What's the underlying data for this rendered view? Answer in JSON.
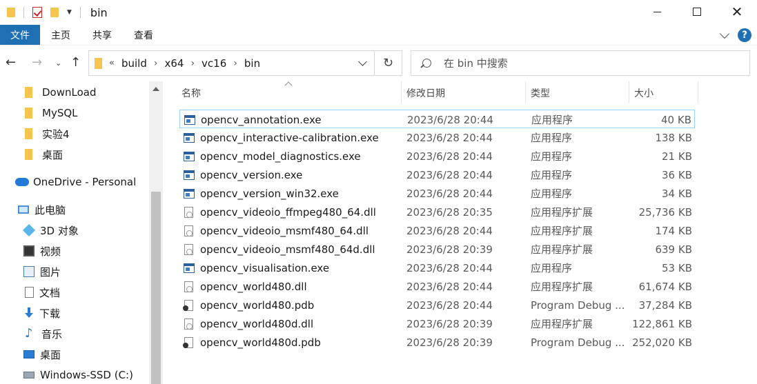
{
  "window": {
    "title": "bin"
  },
  "ribbon": {
    "tabs": [
      "文件",
      "主页",
      "共享",
      "查看"
    ]
  },
  "address": {
    "crumbs": [
      "build",
      "x64",
      "vc16",
      "bin"
    ],
    "overflow": "«"
  },
  "search": {
    "placeholder": "在 bin 中搜索"
  },
  "sidebar": {
    "items": [
      {
        "label": "DownLoad",
        "icon": "folder-icon"
      },
      {
        "label": "MySQL",
        "icon": "folder-icon"
      },
      {
        "label": "实验4",
        "icon": "folder-icon"
      },
      {
        "label": "桌面",
        "icon": "folder-icon"
      },
      {
        "label": "OneDrive - Personal",
        "icon": "onedrive-icon"
      },
      {
        "label": "此电脑",
        "icon": "computer-icon"
      },
      {
        "label": "3D 对象",
        "icon": "3d-objects-icon"
      },
      {
        "label": "视频",
        "icon": "video-icon"
      },
      {
        "label": "图片",
        "icon": "picture-icon"
      },
      {
        "label": "文档",
        "icon": "document-icon"
      },
      {
        "label": "下载",
        "icon": "download-icon"
      },
      {
        "label": "音乐",
        "icon": "music-icon"
      },
      {
        "label": "桌面",
        "icon": "desktop-icon"
      },
      {
        "label": "Windows-SSD (C:)",
        "icon": "drive-icon"
      }
    ]
  },
  "columns": {
    "name": "名称",
    "date": "修改日期",
    "type": "类型",
    "size": "大小"
  },
  "files": [
    {
      "name": "opencv_annotation.exe",
      "date": "2023/6/28 20:44",
      "type": "应用程序",
      "size": "40 KB",
      "kind": "exe"
    },
    {
      "name": "opencv_interactive-calibration.exe",
      "date": "2023/6/28 20:44",
      "type": "应用程序",
      "size": "138 KB",
      "kind": "exe"
    },
    {
      "name": "opencv_model_diagnostics.exe",
      "date": "2023/6/28 20:44",
      "type": "应用程序",
      "size": "21 KB",
      "kind": "exe"
    },
    {
      "name": "opencv_version.exe",
      "date": "2023/6/28 20:44",
      "type": "应用程序",
      "size": "36 KB",
      "kind": "exe"
    },
    {
      "name": "opencv_version_win32.exe",
      "date": "2023/6/28 20:44",
      "type": "应用程序",
      "size": "34 KB",
      "kind": "exe"
    },
    {
      "name": "opencv_videoio_ffmpeg480_64.dll",
      "date": "2023/6/28 20:35",
      "type": "应用程序扩展",
      "size": "25,736 KB",
      "kind": "dll"
    },
    {
      "name": "opencv_videoio_msmf480_64.dll",
      "date": "2023/6/28 20:44",
      "type": "应用程序扩展",
      "size": "174 KB",
      "kind": "dll"
    },
    {
      "name": "opencv_videoio_msmf480_64d.dll",
      "date": "2023/6/28 20:39",
      "type": "应用程序扩展",
      "size": "639 KB",
      "kind": "dll"
    },
    {
      "name": "opencv_visualisation.exe",
      "date": "2023/6/28 20:44",
      "type": "应用程序",
      "size": "53 KB",
      "kind": "exe"
    },
    {
      "name": "opencv_world480.dll",
      "date": "2023/6/28 20:44",
      "type": "应用程序扩展",
      "size": "61,674 KB",
      "kind": "dll"
    },
    {
      "name": "opencv_world480.pdb",
      "date": "2023/6/28 20:44",
      "type": "Program Debug ...",
      "size": "37,284 KB",
      "kind": "pdb"
    },
    {
      "name": "opencv_world480d.dll",
      "date": "2023/6/28 20:39",
      "type": "应用程序扩展",
      "size": "122,861 KB",
      "kind": "dll"
    },
    {
      "name": "opencv_world480d.pdb",
      "date": "2023/6/28 20:39",
      "type": "Program Debug ...",
      "size": "252,020 KB",
      "kind": "pdb"
    }
  ]
}
